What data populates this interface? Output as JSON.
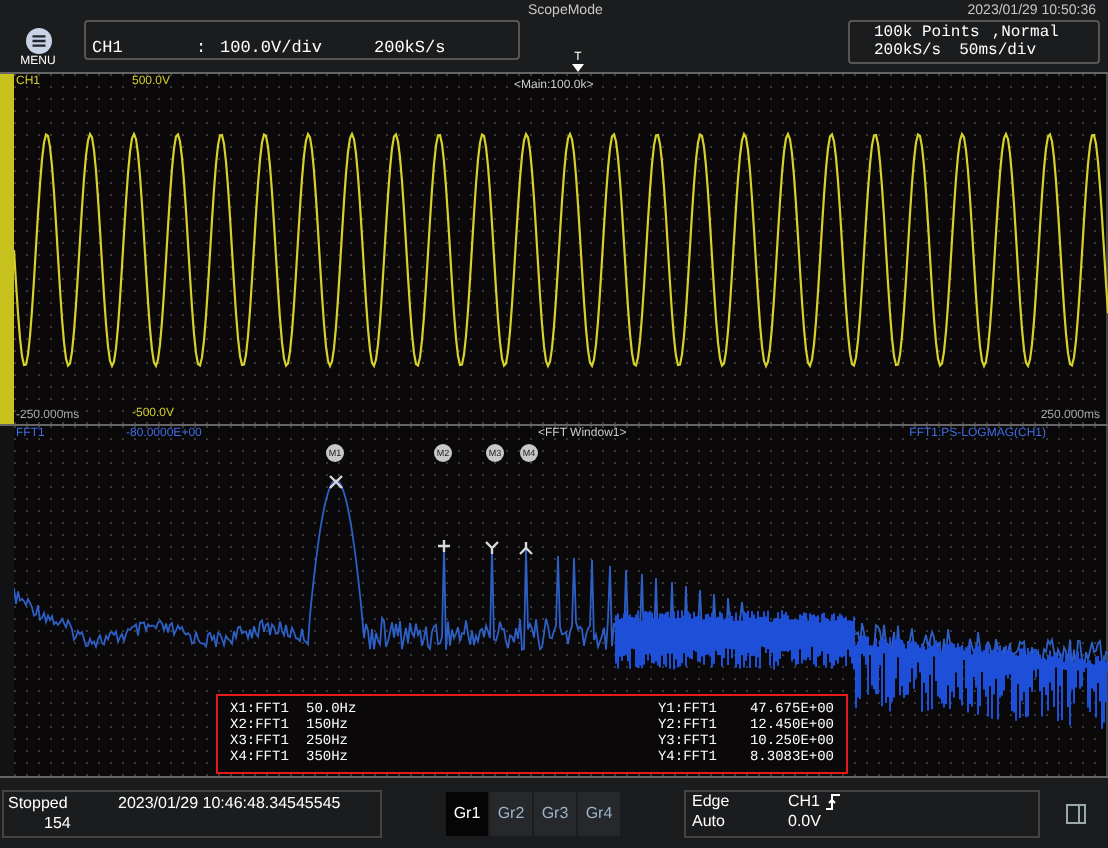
{
  "header": {
    "mode": "ScopeMode",
    "datetime": "2023/01/29 10:50:36",
    "menu_label": "MENU",
    "channel": {
      "name": "CH1",
      "separator": ":",
      "scale": "100.0V/div",
      "rate": "200kS/s"
    },
    "acquisition": {
      "points": "100k Points",
      "mode": ",Normal",
      "rate": "200kS/s",
      "timebase": "50ms/div"
    },
    "trigger_mark": "T"
  },
  "waveform_panel": {
    "channel": "CH1",
    "top_value": "500.0V",
    "title": "<Main:100.0k>",
    "bottom_value": "-500.0V",
    "left_time": "-250.000ms",
    "right_time": "250.000ms"
  },
  "fft_panel": {
    "name": "FFT1",
    "top_value": "-80.0000E+00",
    "title": "<FFT Window1>",
    "function": "FFT1:PS-LOGMAG(CH1)",
    "markers": [
      {
        "label": "M1"
      },
      {
        "label": "M2"
      },
      {
        "label": "M3"
      },
      {
        "label": "M4"
      }
    ],
    "readouts": [
      {
        "x": "X1:FFT1",
        "x_value": "50.0Hz",
        "y": "Y1:FFT1",
        "y_value": "47.675E+00"
      },
      {
        "x": "X2:FFT1",
        "x_value": "150Hz",
        "y": "Y2:FFT1",
        "y_value": "12.450E+00"
      },
      {
        "x": "X3:FFT1",
        "x_value": "250Hz",
        "y": "Y3:FFT1",
        "y_value": "10.250E+00"
      },
      {
        "x": "X4:FFT1",
        "x_value": "350Hz",
        "y": "Y4:FFT1",
        "y_value": "8.3083E+00"
      }
    ]
  },
  "status": {
    "state": "Stopped",
    "count": "154",
    "timestamp": "2023/01/29 10:46:48.34545545",
    "tabs": [
      {
        "label": "Gr1",
        "selected": true
      },
      {
        "label": "Gr2",
        "selected": false
      },
      {
        "label": "Gr3",
        "selected": false
      },
      {
        "label": "Gr4",
        "selected": false
      }
    ],
    "trigger": {
      "type": "Edge",
      "source": "CH1",
      "mode": "Auto",
      "level": "0.0V"
    }
  }
}
